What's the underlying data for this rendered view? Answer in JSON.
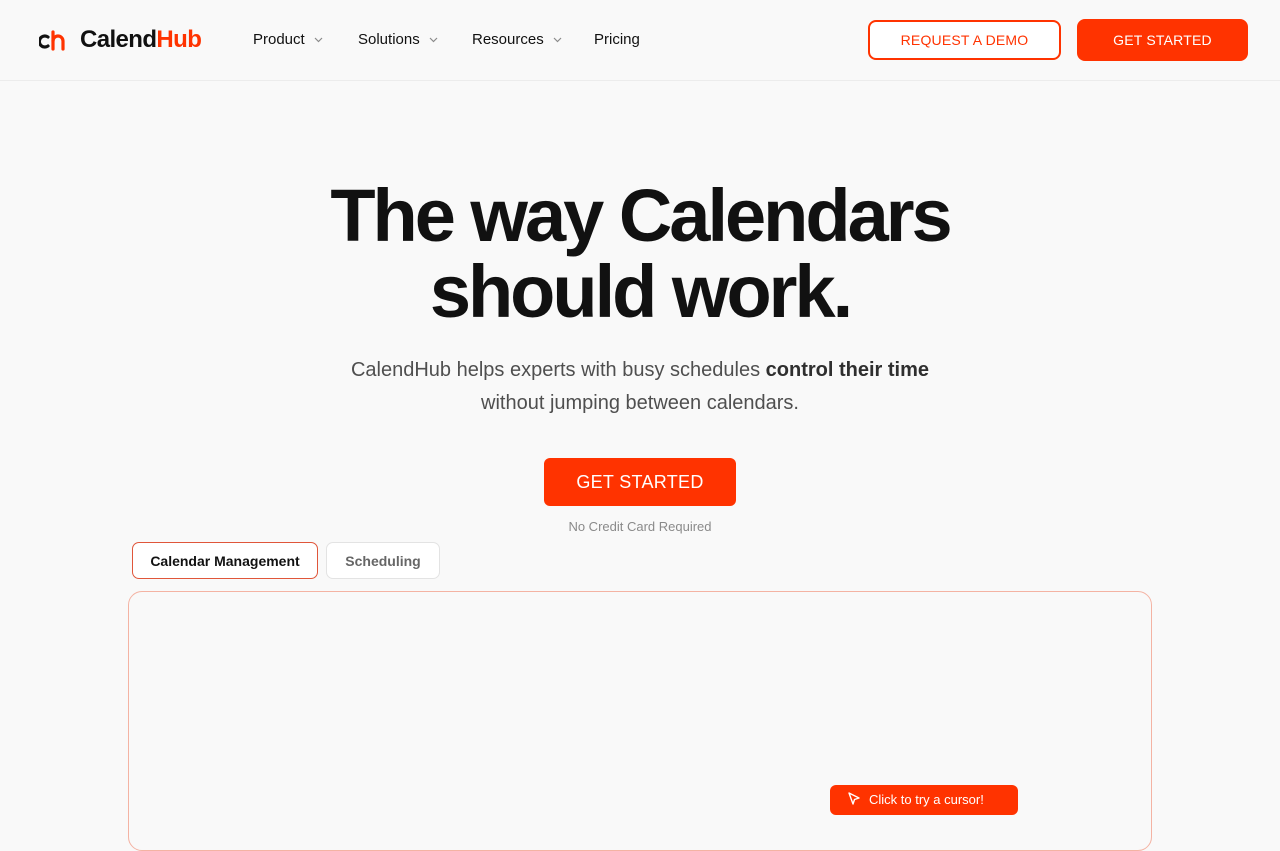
{
  "brand": {
    "name_part1": "Calend",
    "name_part2": "Hub",
    "logo_icon": "ch-monogram-icon",
    "accent_color": "#ff3300"
  },
  "nav": {
    "items": [
      {
        "label": "Product",
        "has_dropdown": true
      },
      {
        "label": "Solutions",
        "has_dropdown": true
      },
      {
        "label": "Resources",
        "has_dropdown": true
      },
      {
        "label": "Pricing",
        "has_dropdown": false
      }
    ],
    "request_demo_label": "REQUEST A DEMO",
    "get_started_label": "GET STARTED"
  },
  "hero": {
    "title_line1": "The way Calendars",
    "title_line2": "should work.",
    "subtitle_pre": "CalendHub helps experts with busy schedules ",
    "subtitle_bold": "control their time",
    "subtitle_post": "without jumping between calendars.",
    "cta_label": "GET STARTED",
    "note": "No Credit Card Required"
  },
  "tabs": [
    {
      "label": "Calendar Management",
      "active": true
    },
    {
      "label": "Scheduling",
      "active": false
    }
  ],
  "demo": {
    "hint_label": "Click to try a cursor!"
  }
}
